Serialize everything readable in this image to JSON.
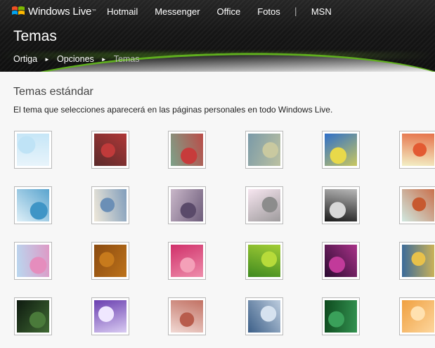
{
  "nav": {
    "brand": "Windows Live",
    "brand_tm": "™",
    "links": [
      "Hotmail",
      "Messenger",
      "Office",
      "Fotos"
    ],
    "separator": "|",
    "msn": "MSN"
  },
  "header": {
    "title": "Temas",
    "breadcrumb": [
      "Ortiga",
      "Opciones"
    ],
    "breadcrumb_arrow": "►",
    "breadcrumb_current": "Temas"
  },
  "main": {
    "section_title": "Temas estándar",
    "section_desc": "El tema que selecciones aparecerá en las páginas personales en todo Windows Live."
  },
  "themes": [
    [
      "#e8f4fb",
      "#bfe3f6"
    ],
    [
      "#5a2a2a",
      "#c03a3a"
    ],
    [
      "#7ca38a",
      "#c73b3b"
    ],
    [
      "#7a9aa8",
      "#c9c9a0"
    ],
    [
      "#2f6fc9",
      "#e8d94a"
    ],
    [
      "#f3f0c6",
      "#e35a32"
    ],
    [
      "#dff0f8",
      "#3f95c6"
    ],
    [
      "#efe8d9",
      "#6b8fb6"
    ],
    [
      "#c9b7c9",
      "#5a4a6a"
    ],
    [
      "#f7e6f0",
      "#8c8c8c"
    ],
    [
      "#1a1a1a",
      "#d8d8d8"
    ],
    [
      "#d0e8e0",
      "#c7592f"
    ],
    [
      "#b9d8f0",
      "#e58dbd"
    ],
    [
      "#8a4a10",
      "#c77a1c"
    ],
    [
      "#d0306a",
      "#f4a0b8"
    ],
    [
      "#3f8a1f",
      "#b7db3a"
    ],
    [
      "#2a0a30",
      "#c23a9a"
    ],
    [
      "#3a6a9a",
      "#e8c14a"
    ],
    [
      "#0e1a10",
      "#4a7a3a"
    ],
    [
      "#6a3fb0",
      "#efe7ff"
    ],
    [
      "#f1d9d4",
      "#b85c4c"
    ],
    [
      "#3c5f88",
      "#d6e2ef"
    ],
    [
      "#0e4a1e",
      "#3aa05a"
    ],
    [
      "#f0a040",
      "#ffe1b0"
    ]
  ],
  "colors": {
    "accent_green": "#5fae1e",
    "header_dark": "#161616"
  }
}
